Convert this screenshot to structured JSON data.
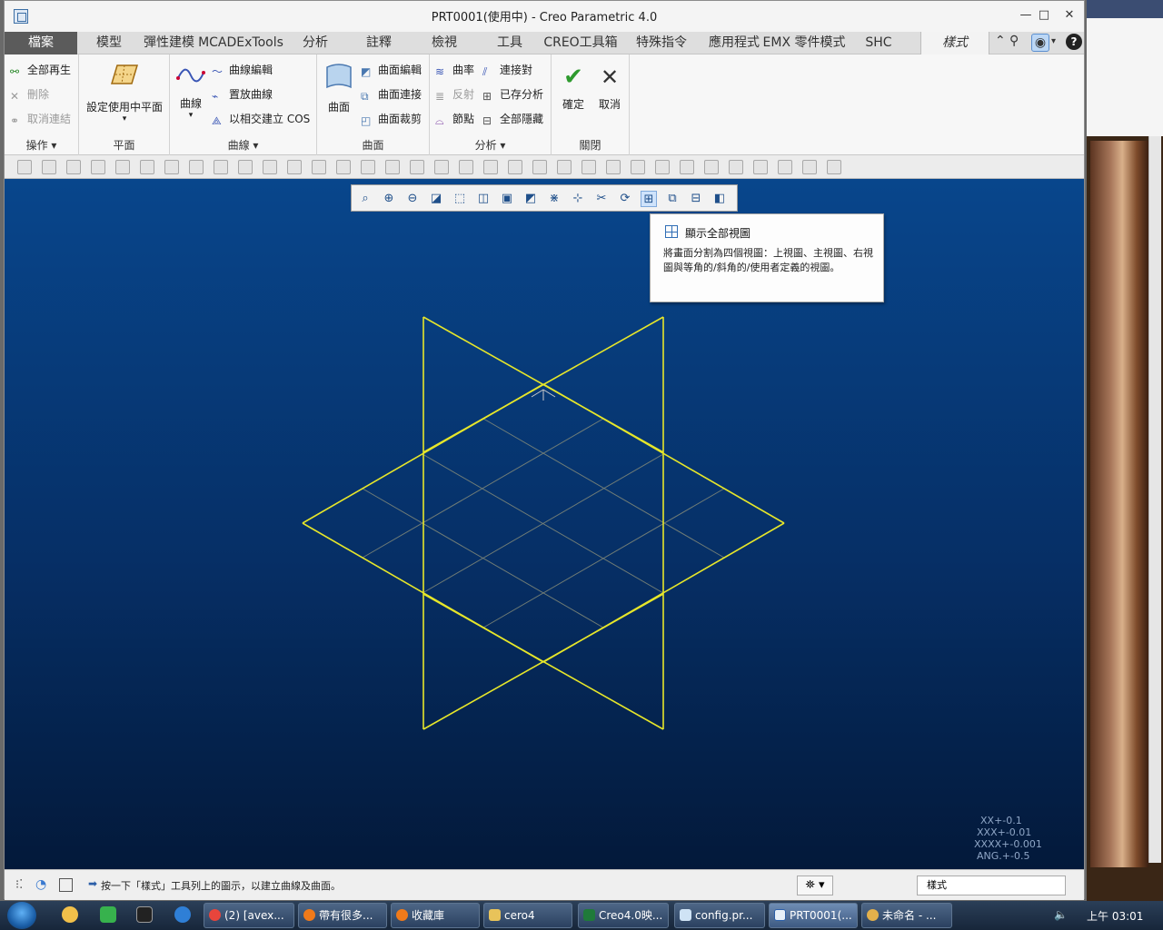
{
  "window": {
    "title": "PRT0001(使用中) - Creo Parametric 4.0",
    "controls": [
      "—",
      "□",
      "✕"
    ]
  },
  "tabs": [
    "檔案",
    "模型",
    "彈性建模",
    "MCADExTools",
    "分析",
    "註釋",
    "檢視",
    "工具",
    "CREO工具箱",
    "特殊指令",
    "應用程式",
    "EMX 零件模式",
    "SHC",
    "樣式"
  ],
  "ribbon": {
    "operations": {
      "label": "操作 ▾",
      "items": [
        "全部再生",
        "刪除",
        "取消連結"
      ]
    },
    "plane": {
      "label": "平面",
      "button": "設定使用中平面"
    },
    "curves": {
      "label": "曲線 ▾",
      "big": "曲線",
      "items": [
        "曲線編輯",
        "置放曲線",
        "以相交建立 COS"
      ]
    },
    "surfaces": {
      "label": "曲面",
      "big": "曲面",
      "items": [
        "曲面編輯",
        "曲面連接",
        "曲面裁剪"
      ]
    },
    "analysis": {
      "label": "分析 ▾",
      "items": [
        "曲率",
        "反射",
        "節點",
        "連接對",
        "已存分析",
        "全部隱藏"
      ]
    },
    "close": {
      "label": "關閉",
      "ok": "確定",
      "cancel": "取消"
    }
  },
  "tooltip": {
    "title": "顯示全部視圖",
    "body": "將畫面分割為四個視圖：上視圖、主視圖、右視圖與等角的/斜角的/使用者定義的視圖。"
  },
  "tolerance": [
    "XX+-0.1",
    "XXX+-0.01",
    "XXXX+-0.001",
    "ANG.+-0.5"
  ],
  "status": {
    "message": "按一下「樣式」工具列上的圖示，以建立曲線及曲面。",
    "filter": "樣式"
  },
  "taskbar": {
    "items": [
      "(2) [avex...",
      "帶有很多...",
      "收藏庫",
      "cero4",
      "Creo4.0映...",
      "config.pr...",
      "PRT0001(...",
      "未命名 - ..."
    ],
    "clock": "上午 03:01"
  },
  "colors": {
    "viewport_top": "#08468c",
    "viewport_bottom": "#03193a",
    "sketch": "#e6e62a",
    "grid": "#8a8f7a"
  }
}
